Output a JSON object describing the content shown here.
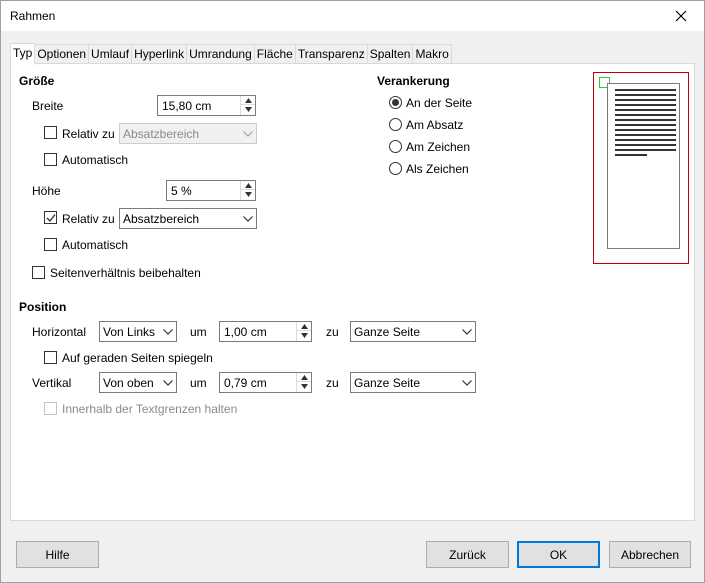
{
  "window": {
    "title": "Rahmen"
  },
  "tabs": [
    "Typ",
    "Optionen",
    "Umlauf",
    "Hyperlink",
    "Umrandung",
    "Fläche",
    "Transparenz",
    "Spalten",
    "Makro"
  ],
  "size": {
    "heading": "Größe",
    "width_label": "Breite",
    "width_value": "15,80 cm",
    "width_relative_label": "Relativ zu",
    "width_relative_checked": false,
    "width_relative_option": "Absatzbereich",
    "width_auto_label": "Automatisch",
    "height_label": "Höhe",
    "height_value": "5 %",
    "height_relative_label": "Relativ zu",
    "height_relative_checked": true,
    "height_relative_option": "Absatzbereich",
    "height_auto_label": "Automatisch",
    "keep_ratio_label": "Seitenverhältnis beibehalten"
  },
  "anchor": {
    "heading": "Verankerung",
    "options": [
      "An der Seite",
      "Am Absatz",
      "Am Zeichen",
      "Als Zeichen"
    ],
    "selected": "An der Seite"
  },
  "position": {
    "heading": "Position",
    "horizontal_label": "Horizontal",
    "horizontal_option": "Von Links",
    "by_label": "um",
    "horizontal_value": "1,00 cm",
    "to_label": "zu",
    "horizontal_to": "Ganze Seite",
    "mirror_label": "Auf geraden Seiten spiegeln",
    "vertical_label": "Vertikal",
    "vertical_option": "Von oben",
    "vertical_value": "0,79 cm",
    "vertical_to": "Ganze Seite",
    "follow_text_label": "Innerhalb der Textgrenzen halten"
  },
  "buttons": {
    "help": "Hilfe",
    "reset": "Zurück",
    "ok": "OK",
    "cancel": "Abbrechen"
  },
  "colors": {
    "preview_border": "#c00000",
    "frame_marker": "#38c738",
    "default_button": "#0078d7"
  },
  "icons": [
    "close-icon",
    "checkmark-icon",
    "spin-up-icon",
    "spin-down-icon",
    "dropdown-arrow-icon"
  ]
}
